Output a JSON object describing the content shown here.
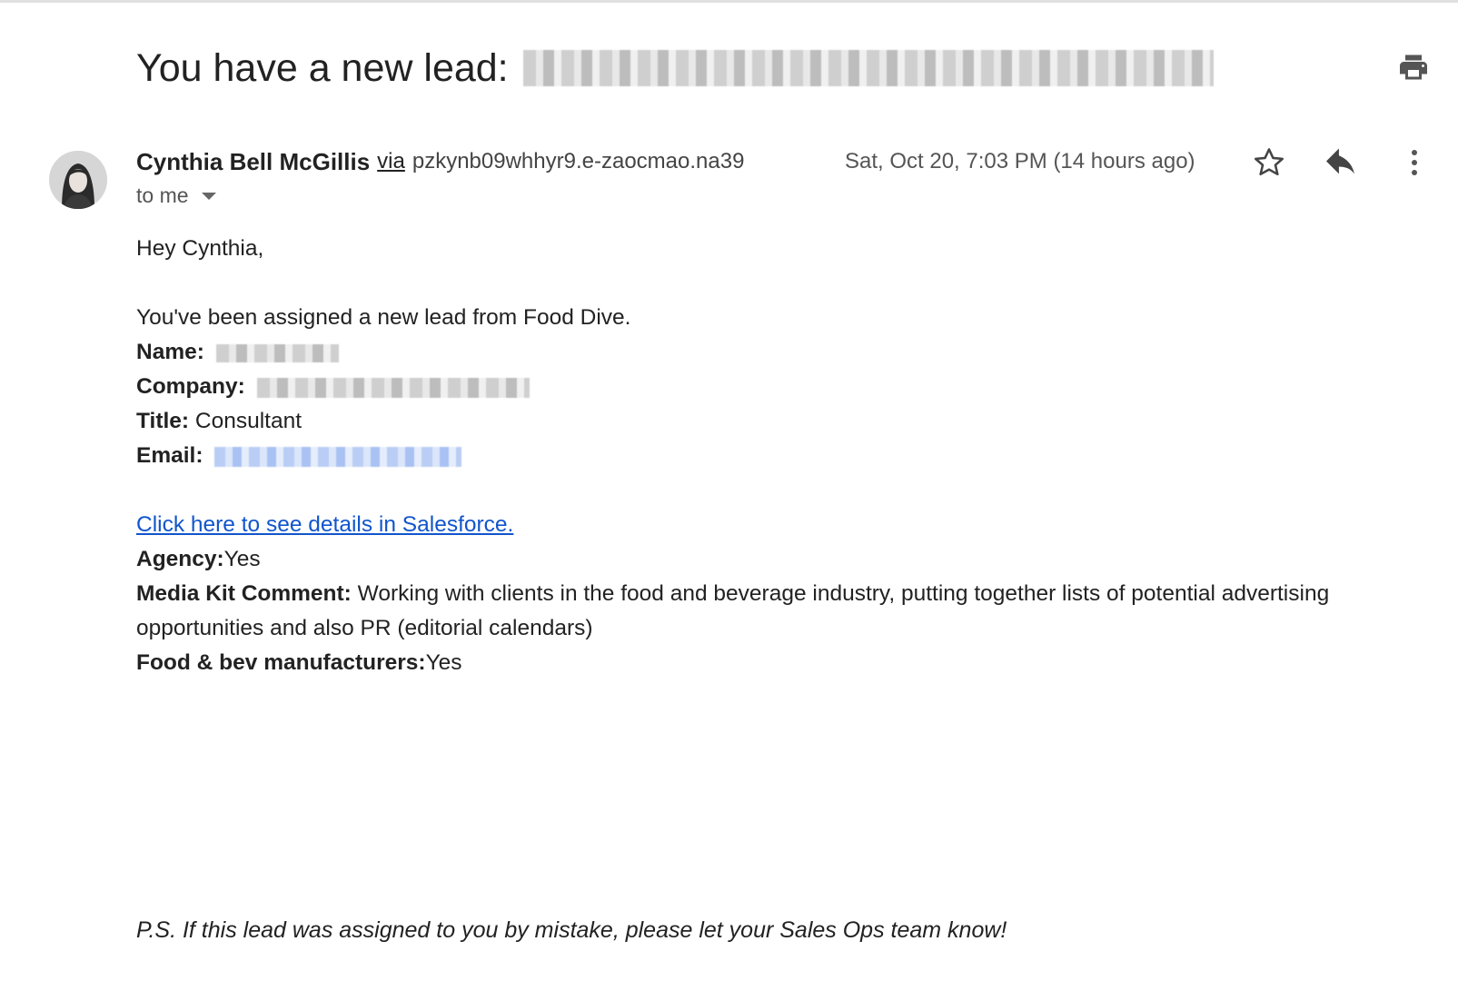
{
  "subject": {
    "prefix": "You have a new lead:"
  },
  "sender": {
    "name": "Cynthia Bell McGillis",
    "via_label": "via",
    "via_address": "pzkynb09whhyr9.e-zaocmao.na39",
    "recipient": "to me",
    "date": "Sat, Oct 20, 7:03 PM (14 hours ago)"
  },
  "icons": {
    "print": "printer-icon",
    "star": "star-icon",
    "reply": "reply-icon",
    "more": "more-vertical-icon",
    "recipient_dropdown": "chevron-down-icon"
  },
  "body": {
    "greeting": "Hey Cynthia,",
    "intro": "You've been assigned a new lead from Food Dive.",
    "name_label": "Name:",
    "company_label": "Company:",
    "title_label": "Title:",
    "title_value": "Consultant",
    "email_label": "Email:",
    "salesforce_link": "Click here to see details in Salesforce.",
    "agency_label": "Agency:",
    "agency_value": "Yes",
    "media_kit_label": "Media Kit Comment:",
    "media_kit_value": "Working with clients in the food and beverage industry, putting together lists of potential advertising opportunities and also PR (editorial calendars)",
    "food_bev_label": "Food & bev manufacturers:",
    "food_bev_value": "Yes",
    "ps": "P.S. If this lead was assigned to you by mistake, please let your Sales Ops team know!"
  },
  "colors": {
    "link": "#1155cc",
    "text": "#222222",
    "muted": "#555555"
  }
}
